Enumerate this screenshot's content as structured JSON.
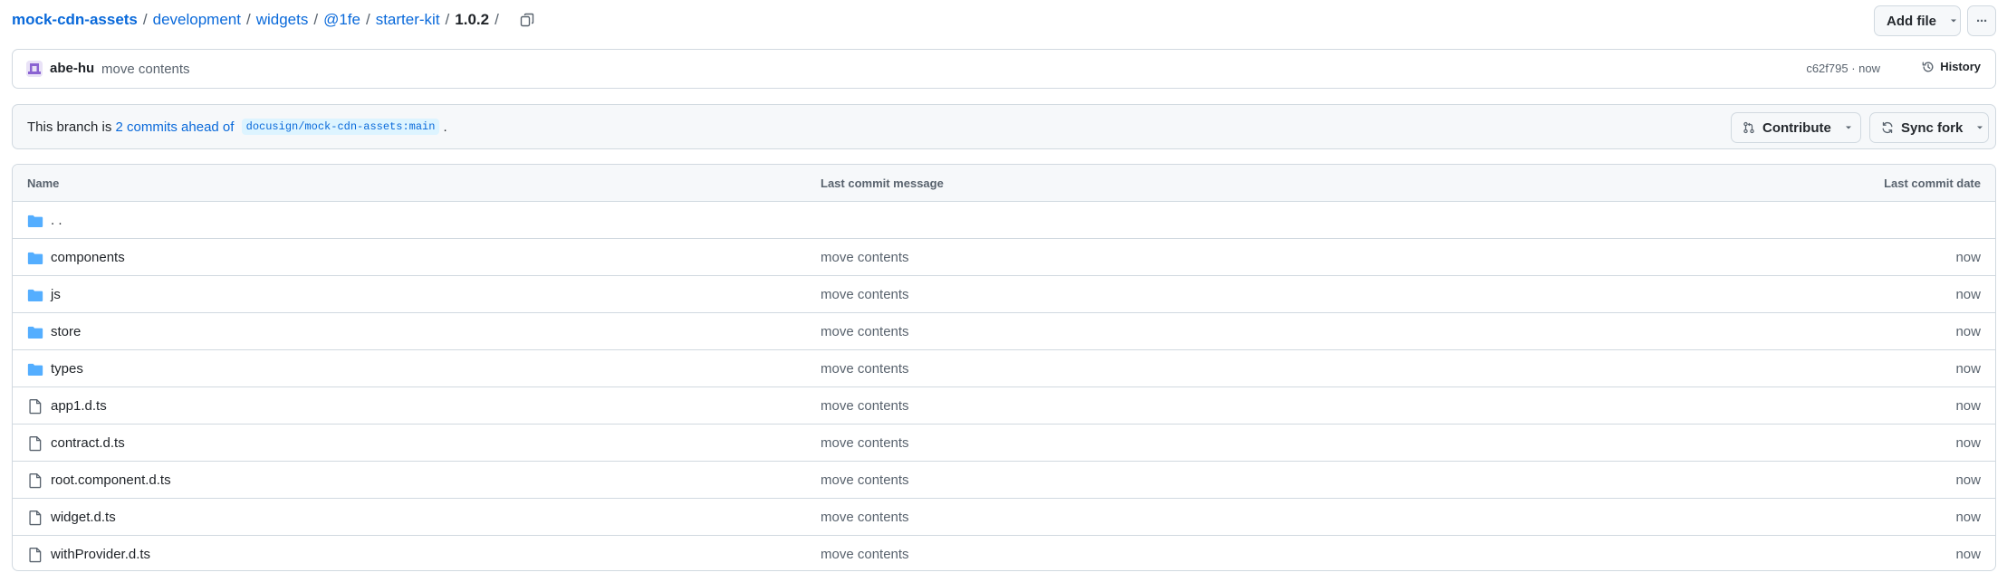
{
  "breadcrumb": {
    "repo": "mock-cdn-assets",
    "path": [
      "development",
      "widgets",
      "@1fe",
      "starter-kit"
    ],
    "current": "1.0.2",
    "separator": "/"
  },
  "toolbar": {
    "add_file_label": "Add file",
    "more_label": "···"
  },
  "commit": {
    "author": "abe-hu",
    "message": "move contents",
    "hash": "c62f795",
    "time": "now",
    "meta": "c62f795 · now",
    "history_label": "History"
  },
  "branch_notice": {
    "prefix": "This branch is ",
    "link_text": "2 commits ahead of",
    "ref": "docusign/mock-cdn-assets:main",
    "suffix": ".",
    "contribute_label": "Contribute",
    "sync_fork_label": "Sync fork"
  },
  "table": {
    "headers": {
      "name": "Name",
      "message": "Last commit message",
      "date": "Last commit date"
    },
    "rows": [
      {
        "type": "folder",
        "name": ". .",
        "message": "",
        "date": ""
      },
      {
        "type": "folder",
        "name": "components",
        "message": "move contents",
        "date": "now"
      },
      {
        "type": "folder",
        "name": "js",
        "message": "move contents",
        "date": "now"
      },
      {
        "type": "folder",
        "name": "store",
        "message": "move contents",
        "date": "now"
      },
      {
        "type": "folder",
        "name": "types",
        "message": "move contents",
        "date": "now"
      },
      {
        "type": "file",
        "name": "app1.d.ts",
        "message": "move contents",
        "date": "now"
      },
      {
        "type": "file",
        "name": "contract.d.ts",
        "message": "move contents",
        "date": "now"
      },
      {
        "type": "file",
        "name": "root.component.d.ts",
        "message": "move contents",
        "date": "now"
      },
      {
        "type": "file",
        "name": "widget.d.ts",
        "message": "move contents",
        "date": "now"
      },
      {
        "type": "file",
        "name": "withProvider.d.ts",
        "message": "move contents",
        "date": "now"
      }
    ]
  },
  "colors": {
    "link": "#0969da",
    "folder_icon": "#54aeff",
    "muted_text": "#59636e",
    "border": "#d1d9e0"
  }
}
